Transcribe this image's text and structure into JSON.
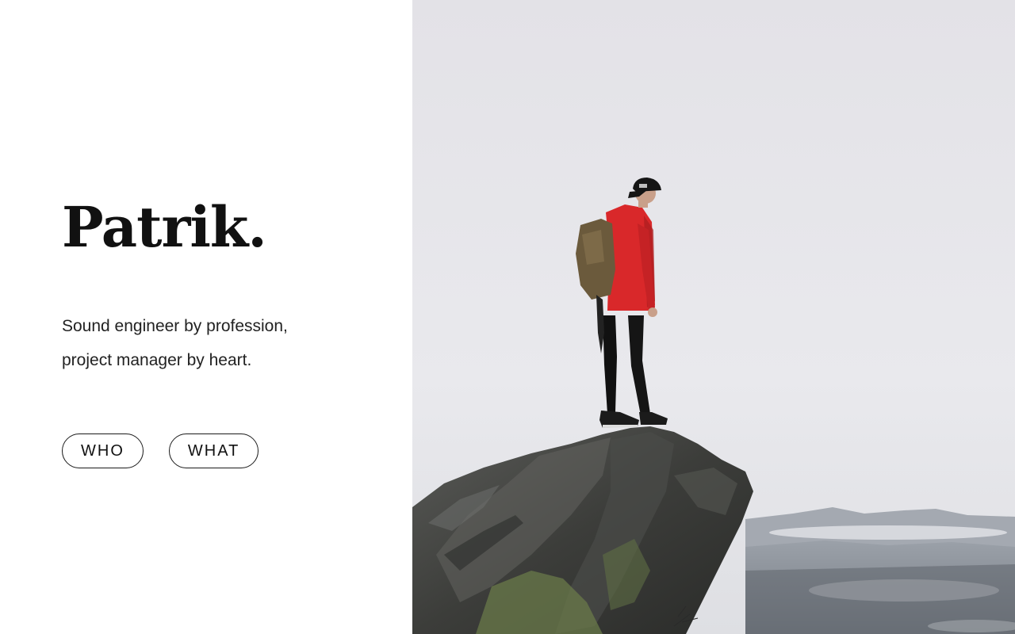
{
  "hero": {
    "name": "Patrik.",
    "tagline_line1": "Sound engineer by profession,",
    "tagline_line2": "project manager by heart."
  },
  "nav": {
    "who_label": "WHO",
    "what_label": "WHAT"
  },
  "photo": {
    "subject": "hiker-on-cliff-photo",
    "colors": {
      "sky": "#e6e5ea",
      "jacket": "#d9282a",
      "rock": "#3e3f3d",
      "backpack": "#6b5a3c"
    }
  }
}
